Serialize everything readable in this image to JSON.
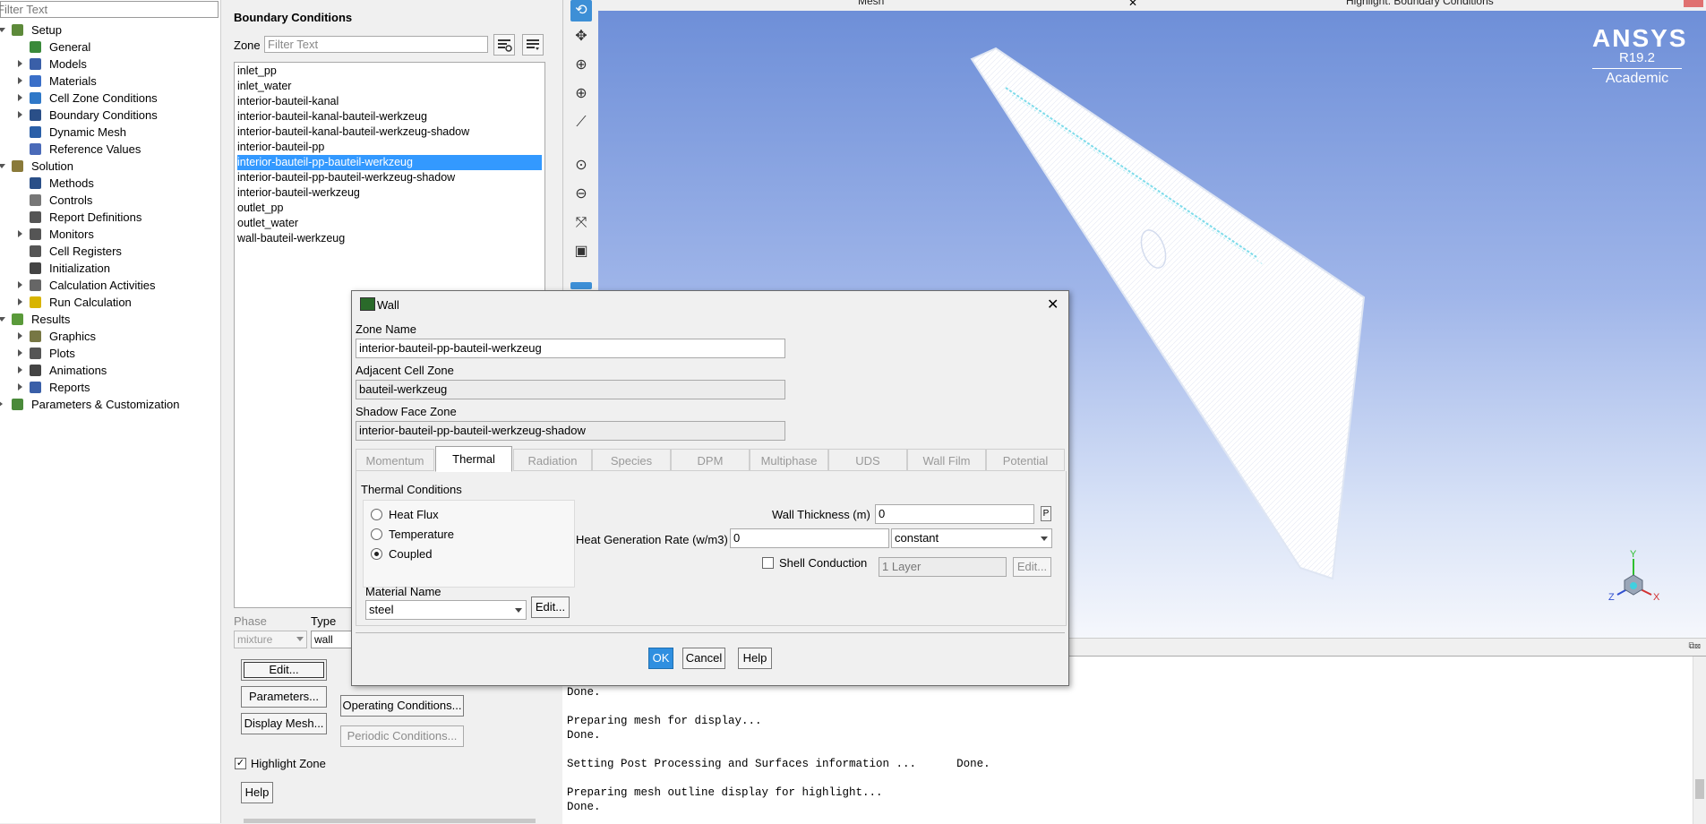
{
  "tree": {
    "filter_placeholder": "Filter Text",
    "items": [
      {
        "label": "Setup",
        "level": 0,
        "arrow": "down",
        "icon": "setup-icon",
        "color": "#5d8a3a"
      },
      {
        "label": "General",
        "level": 1,
        "arrow": "",
        "icon": "general-icon",
        "color": "#3a8a3a"
      },
      {
        "label": "Models",
        "level": 1,
        "arrow": "right",
        "icon": "models-icon",
        "color": "#3a5fa8"
      },
      {
        "label": "Materials",
        "level": 1,
        "arrow": "right",
        "icon": "materials-icon",
        "color": "#3a6fc8"
      },
      {
        "label": "Cell Zone Conditions",
        "level": 1,
        "arrow": "right",
        "icon": "cell-zone-icon",
        "color": "#2f78c8"
      },
      {
        "label": "Boundary Conditions",
        "level": 1,
        "arrow": "right",
        "icon": "boundary-icon",
        "color": "#2a4f88"
      },
      {
        "label": "Dynamic Mesh",
        "level": 1,
        "arrow": "",
        "icon": "dynamic-mesh-icon",
        "color": "#2a5fa8"
      },
      {
        "label": "Reference Values",
        "level": 1,
        "arrow": "",
        "icon": "reference-icon",
        "color": "#4a6ab8"
      },
      {
        "label": "Solution",
        "level": 0,
        "arrow": "down",
        "icon": "solution-icon",
        "color": "#8a7a3a"
      },
      {
        "label": "Methods",
        "level": 1,
        "arrow": "",
        "icon": "methods-icon",
        "color": "#2a4f88"
      },
      {
        "label": "Controls",
        "level": 1,
        "arrow": "",
        "icon": "controls-icon",
        "color": "#777777"
      },
      {
        "label": "Report Definitions",
        "level": 1,
        "arrow": "",
        "icon": "report-def-icon",
        "color": "#555555"
      },
      {
        "label": "Monitors",
        "level": 1,
        "arrow": "right",
        "icon": "monitors-icon",
        "color": "#555555"
      },
      {
        "label": "Cell Registers",
        "level": 1,
        "arrow": "",
        "icon": "cell-registers-icon",
        "color": "#555555"
      },
      {
        "label": "Initialization",
        "level": 1,
        "arrow": "",
        "icon": "initialization-icon",
        "color": "#444444"
      },
      {
        "label": "Calculation Activities",
        "level": 1,
        "arrow": "right",
        "icon": "calc-activities-icon",
        "color": "#666666"
      },
      {
        "label": "Run Calculation",
        "level": 1,
        "arrow": "right",
        "icon": "run-calc-icon",
        "color": "#d8b400"
      },
      {
        "label": "Results",
        "level": 0,
        "arrow": "down",
        "icon": "results-icon",
        "color": "#5a9a3a"
      },
      {
        "label": "Graphics",
        "level": 1,
        "arrow": "right",
        "icon": "graphics-icon",
        "color": "#777744"
      },
      {
        "label": "Plots",
        "level": 1,
        "arrow": "right",
        "icon": "plots-icon",
        "color": "#555555"
      },
      {
        "label": "Animations",
        "level": 1,
        "arrow": "right",
        "icon": "animations-icon",
        "color": "#444444"
      },
      {
        "label": "Reports",
        "level": 1,
        "arrow": "right",
        "icon": "reports-icon",
        "color": "#3a5fa8"
      },
      {
        "label": "Parameters & Customization",
        "level": 0,
        "arrow": "right",
        "icon": "parameters-icon",
        "color": "#4a8a3a"
      }
    ]
  },
  "bc": {
    "title": "Boundary Conditions",
    "zone_label": "Zone",
    "filter_placeholder": "Filter Text",
    "zones": [
      "inlet_pp",
      "inlet_water",
      "interior-bauteil-kanal",
      "interior-bauteil-kanal-bauteil-werkzeug",
      "interior-bauteil-kanal-bauteil-werkzeug-shadow",
      "interior-bauteil-pp",
      "interior-bauteil-pp-bauteil-werkzeug",
      "interior-bauteil-pp-bauteil-werkzeug-shadow",
      "interior-bauteil-werkzeug",
      "outlet_pp",
      "outlet_water",
      "wall-bauteil-werkzeug"
    ],
    "selected_index": 6,
    "phase_label": "Phase",
    "phase_value": "mixture",
    "type_label": "Type",
    "type_value": "wall",
    "edit": "Edit...",
    "parameters": "Parameters...",
    "display_mesh": "Display Mesh...",
    "operating_conditions": "Operating Conditions...",
    "periodic_conditions": "Periodic Conditions...",
    "highlight_zone": "Highlight Zone",
    "highlight_checked": true,
    "help": "Help"
  },
  "graphics": {
    "tab1": "Mesh",
    "tab2": "Highlight: Boundary Conditions",
    "logo_brand": "ANSYS",
    "logo_version": "R19.2",
    "logo_edition": "Academic",
    "triad_x": "X",
    "triad_y": "Y",
    "triad_z": "Z"
  },
  "console": {
    "text": "Done.\n\nPreparing mesh for display...\nDone.\n\nSetting Post Processing and Surfaces information ...      Done.\n\nPreparing mesh outline display for highlight...\nDone."
  },
  "dialog": {
    "title": "Wall",
    "zone_name_label": "Zone Name",
    "zone_name": "interior-bauteil-pp-bauteil-werkzeug",
    "adjacent_label": "Adjacent Cell Zone",
    "adjacent": "bauteil-werkzeug",
    "shadow_label": "Shadow Face Zone",
    "shadow": "interior-bauteil-pp-bauteil-werkzeug-shadow",
    "tabs": [
      "Momentum",
      "Thermal",
      "Radiation",
      "Species",
      "DPM",
      "Multiphase",
      "UDS",
      "Wall Film",
      "Potential"
    ],
    "active_tab": "Thermal",
    "thermal_conditions": "Thermal Conditions",
    "radios": [
      {
        "label": "Heat Flux",
        "checked": false
      },
      {
        "label": "Temperature",
        "checked": false
      },
      {
        "label": "Coupled",
        "checked": true
      }
    ],
    "wall_thickness_label": "Wall Thickness (m)",
    "wall_thickness": "0",
    "p_button": "P",
    "heat_gen_label": "Heat Generation Rate (w/m3)",
    "heat_gen": "0",
    "heat_gen_method": "constant",
    "shell_conduction": "Shell Conduction",
    "shell_checked": false,
    "layers": "1 Layer",
    "shell_edit": "Edit...",
    "material_name_label": "Material Name",
    "material_name": "steel",
    "material_edit": "Edit...",
    "ok": "OK",
    "cancel": "Cancel",
    "help": "Help"
  }
}
